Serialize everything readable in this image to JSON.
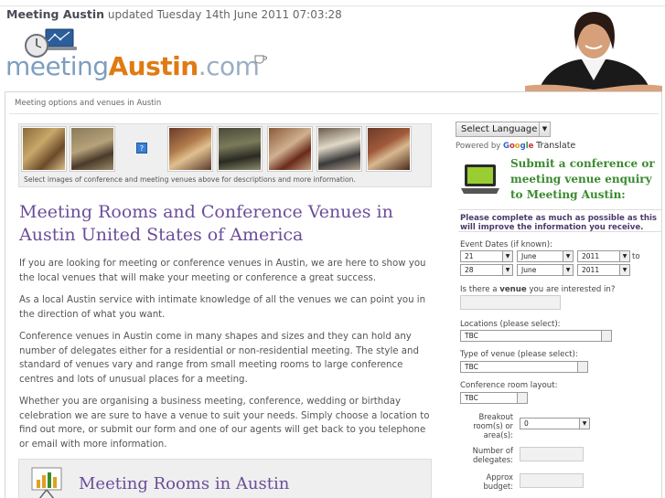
{
  "header": {
    "site_name": "Meeting Austin",
    "updated_text": "updated Tuesday 14th June 2011 07:03:28",
    "logo_part1": "meeting",
    "logo_part2": "Austin",
    "logo_part3": ".com"
  },
  "breadcrumb": "Meeting options and venues in Austin",
  "gallery": {
    "caption": "Select images of conference and meeting venues above for descriptions and more information.",
    "placeholder_icon": "?"
  },
  "main": {
    "title": "Meeting Rooms and Conference Venues in Austin United States of America",
    "paragraphs": [
      "If you are looking for meeting or conference venues in Austin, we are here to show you the local venues that will make your meeting or conference a great success.",
      "As a local Austin service with intimate knowledge of all the venues we can point you in the direction of what you want.",
      "Conference venues in Austin come in many shapes and sizes and they can hold any number of delegates either for a residential or non-residential meeting. The style and standard of venues vary and range from small meeting rooms to large conference centres and lots of unusual places for a meeting.",
      "Whether you are organising a business meeting, conference, wedding or birthday celebration we are sure to have a venue to suit your needs. Simply choose a location to find out more, or submit our form and one of our agents will get back to you telephone or email with more information."
    ],
    "subheading": "Meeting Rooms in Austin"
  },
  "sidebar": {
    "language_button": "Select Language",
    "powered_by": "Powered by",
    "google": "Google",
    "translate": "Translate",
    "promo": "Submit a conference or meeting venue enquiry to Meeting Austin:",
    "notice": "Please complete as much as possible as this will improve the information you receive.",
    "form": {
      "event_dates_label": "Event Dates (if known):",
      "from_day": "21",
      "from_month": "June",
      "from_year": "2011",
      "to_label": "to",
      "to_day": "28",
      "to_month": "June",
      "to_year": "2011",
      "venue_label_pre": "Is there a ",
      "venue_label_bold": "venue",
      "venue_label_post": " you are interested in?",
      "locations_label": "Locations (please select):",
      "locations_value": "TBC",
      "venue_type_label": "Type of venue (please select):",
      "venue_type_value": "TBC",
      "layout_label": "Conference room layout:",
      "layout_value": "TBC",
      "breakout_label": "Breakout room(s) or area(s):",
      "breakout_value": "0",
      "delegates_label": "Number of delegates:",
      "budget_label": "Approx budget:"
    }
  },
  "colors": {
    "title_purple": "#6c4d9a",
    "promo_green": "#3a8a2e",
    "logo_orange": "#e07a12",
    "logo_blue": "#7d9ec0"
  }
}
